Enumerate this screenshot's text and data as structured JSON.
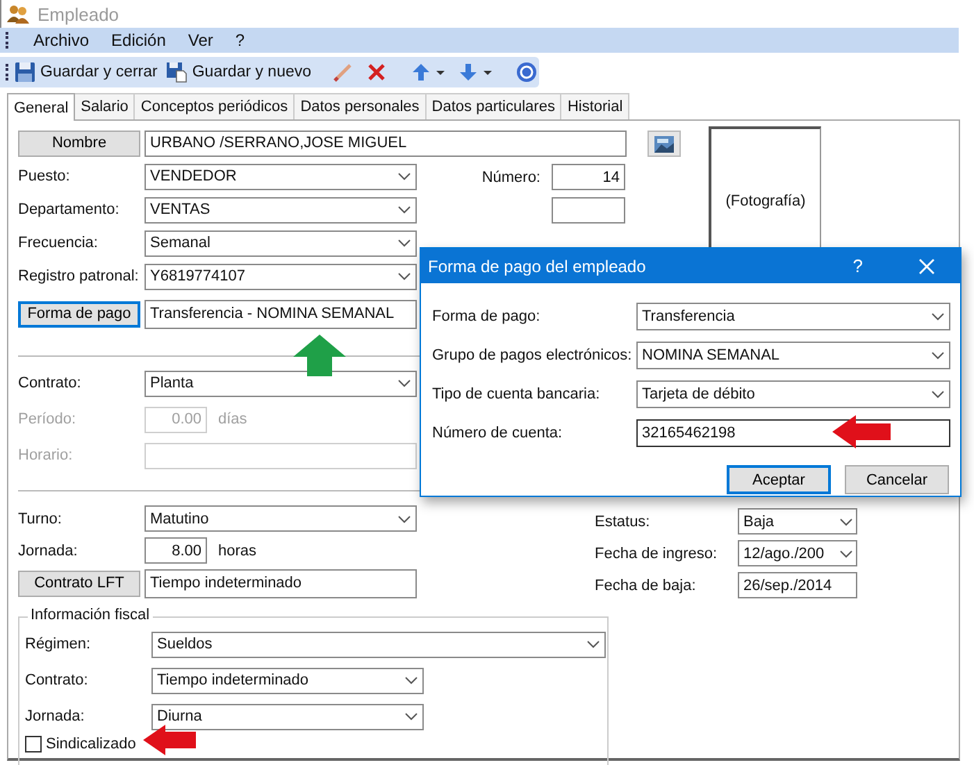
{
  "window": {
    "title": "Empleado"
  },
  "menu": [
    {
      "label": "Archivo"
    },
    {
      "label": "Edición"
    },
    {
      "label": "Ver"
    },
    {
      "label": "?"
    }
  ],
  "toolbar": [
    {
      "kind": "save",
      "label": "Guardar y cerrar"
    },
    {
      "kind": "savenew",
      "label": "Guardar y nuevo"
    },
    {
      "kind": "sep"
    },
    {
      "kind": "edit"
    },
    {
      "kind": "delete"
    },
    {
      "kind": "sep"
    },
    {
      "kind": "up"
    },
    {
      "kind": "down"
    },
    {
      "kind": "sep"
    },
    {
      "kind": "help"
    }
  ],
  "tabs": [
    {
      "label": "General",
      "selected": true
    },
    {
      "label": "Salario",
      "selected": false
    },
    {
      "label": "Conceptos periódicos",
      "selected": false
    },
    {
      "label": "Datos personales",
      "selected": false
    },
    {
      "label": "Datos particulares",
      "selected": false
    },
    {
      "label": "Historial",
      "selected": false
    }
  ],
  "form": {
    "name": {
      "button": "Nombre",
      "value": "URBANO /SERRANO,JOSE MIGUEL"
    },
    "top_fields": [
      {
        "label": "Puesto:",
        "value": "VENDEDOR",
        "kind": "select",
        "disabled": false
      },
      {
        "label": "Departamento:",
        "value": "VENTAS",
        "kind": "select",
        "disabled": false
      },
      {
        "label": "Frecuencia:",
        "value": "Semanal",
        "kind": "select",
        "disabled": false
      },
      {
        "label": "Registro patronal:",
        "value": "Y6819774107",
        "kind": "select",
        "disabled": false
      }
    ],
    "payment": {
      "button": "Forma de pago",
      "value": "Transferencia - NOMINA SEMANAL"
    },
    "contract_fields": [
      {
        "label": "Contrato:",
        "value": "Planta",
        "kind": "select",
        "disabled": false
      },
      {
        "label": "Período:",
        "value": "0.00",
        "unit": "días",
        "kind": "number",
        "disabled": true
      },
      {
        "label": "Horario:",
        "kind": "text",
        "disabled": true
      }
    ],
    "shift_fields": [
      {
        "label": "Turno:",
        "value": "Matutino",
        "kind": "select",
        "disabled": false
      },
      {
        "label": "Jornada:",
        "value": "8.00",
        "unit": "horas",
        "kind": "number",
        "disabled": false
      }
    ],
    "lft": {
      "button": "Contrato LFT",
      "value": "Tiempo indeterminado"
    },
    "number": {
      "label": "Número:",
      "value": "14"
    },
    "photo": "(Fotografía)",
    "status_fields": [
      {
        "label": "Estatus:",
        "value": "Baja",
        "kind": "select"
      },
      {
        "label": "Fecha de ingreso:",
        "value": "12/ago./200",
        "kind": "select"
      },
      {
        "label": "Fecha de baja:",
        "value": "26/sep./2014",
        "kind": "text"
      }
    ],
    "fiscal": {
      "legend": "Información fiscal",
      "fields": [
        {
          "label": "Régimen:",
          "value": "Sueldos",
          "kind": "wideselect",
          "disabled": false
        },
        {
          "label": "Contrato:",
          "value": "Tiempo indeterminado",
          "kind": "select",
          "disabled": false
        },
        {
          "label": "Jornada:",
          "value": "Diurna",
          "kind": "select",
          "disabled": false
        }
      ],
      "checkbox": {
        "label": "Sindicalizado",
        "checked": false
      }
    }
  },
  "dialog": {
    "title": "Forma de pago del empleado",
    "help": "?",
    "fields": [
      {
        "label": "Forma de pago:",
        "value": "Transferencia",
        "kind": "select"
      },
      {
        "label": "Grupo de pagos electrónicos:",
        "value": "NOMINA SEMANAL",
        "kind": "select"
      },
      {
        "label": "Tipo de cuenta bancaria:",
        "value": "Tarjeta de débito",
        "kind": "select"
      },
      {
        "label": "Número de cuenta:",
        "value": "32165462198",
        "kind": "text"
      }
    ],
    "buttons": [
      {
        "label": "Aceptar",
        "default": true
      },
      {
        "label": "Cancelar",
        "default": false
      }
    ]
  }
}
